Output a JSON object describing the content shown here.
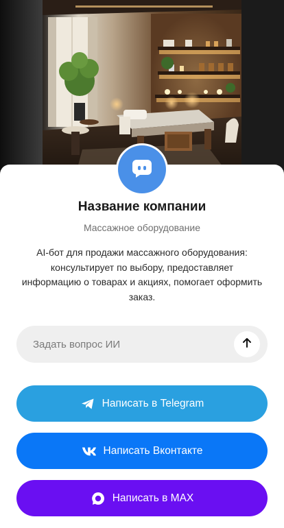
{
  "hero": {
    "image": "massage-room-photo"
  },
  "company": {
    "avatar_icon": "chat-bubble-icon",
    "name": "Название компании",
    "category": "Массажное оборудование",
    "description": "AI-бот для продажи массажного оборудования: консультирует по выбору, предоставляет информацию о товарах и акциях, помогает оформить заказ."
  },
  "ask": {
    "placeholder": "Задать вопрос ИИ",
    "value": "",
    "send_icon": "arrow-up-icon"
  },
  "actions": [
    {
      "label": "Написать в Telegram",
      "icon": "telegram-icon",
      "color": "#2aa0e0"
    },
    {
      "label": "Написать Вконтакте",
      "icon": "vk-icon",
      "color": "#0a77f7"
    },
    {
      "label": "Написать в MAX",
      "icon": "max-icon",
      "color": "#6a0ff2"
    }
  ],
  "colors": {
    "accent": "#4a90e8",
    "input_bg": "#efefef"
  }
}
